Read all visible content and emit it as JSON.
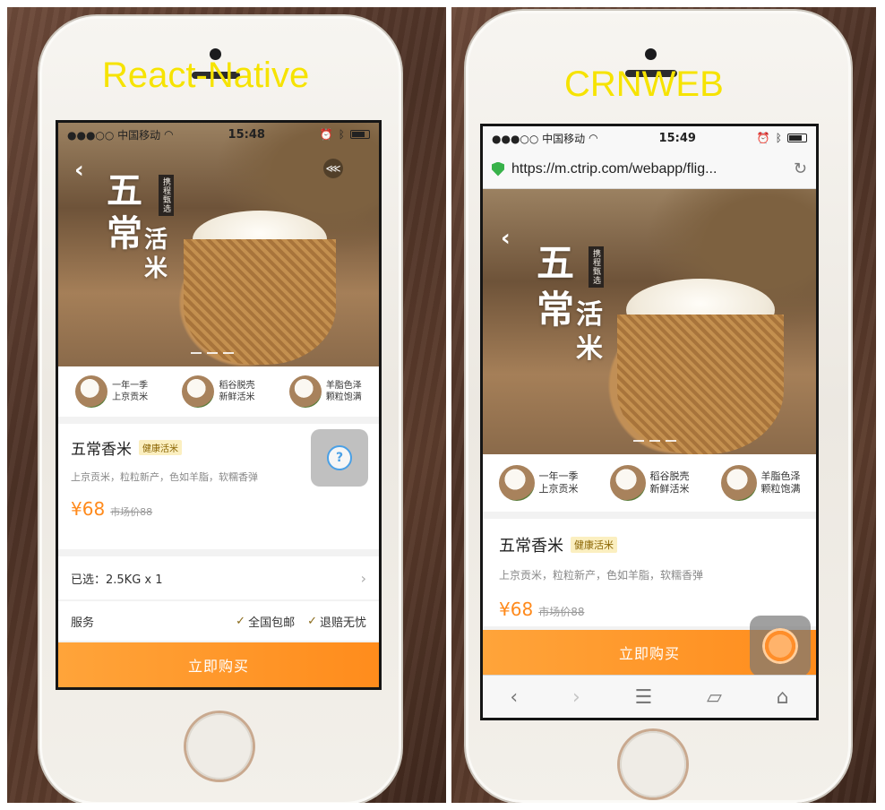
{
  "left": {
    "caption": "React-Native",
    "status": {
      "carrier": "●●●○○ 中国移动",
      "time": "15:48"
    },
    "hero": {
      "char1": "五",
      "char2": "常",
      "char3": "活",
      "char4": "米",
      "seal": "携程甄选"
    },
    "features": [
      {
        "line1": "一年一季",
        "line2": "上京贡米"
      },
      {
        "line1": "稻谷脱壳",
        "line2": "新鲜活米"
      },
      {
        "line1": "羊脂色泽",
        "line2": "颗粒饱满"
      }
    ],
    "product": {
      "title": "五常香米",
      "tag": "健康活米",
      "desc": "上京贡米，粒粒新产，色如羊脂，软糯香弹",
      "price": "¥68",
      "old_price": "市场价88"
    },
    "selected": "已选：2.5KG x 1",
    "service": {
      "label": "服务",
      "items": [
        "全国包邮",
        "退赔无忧"
      ]
    },
    "buy_label": "立即购买"
  },
  "right": {
    "caption": "CRNWEB",
    "status": {
      "carrier": "●●●○○ 中国移动",
      "time": "15:49"
    },
    "url": "https://m.ctrip.com/webapp/flig...",
    "hero": {
      "char1": "五",
      "char2": "常",
      "char3": "活",
      "char4": "米",
      "seal": "携程甄选"
    },
    "features": [
      {
        "line1": "一年一季",
        "line2": "上京贡米"
      },
      {
        "line1": "稻谷脱壳",
        "line2": "新鲜活米"
      },
      {
        "line1": "羊脂色泽",
        "line2": "颗粒饱满"
      }
    ],
    "product": {
      "title": "五常香米",
      "tag": "健康活米",
      "desc": "上京贡米，粒粒新产，色如羊脂，软糯香弹",
      "price": "¥68",
      "old_price": "市场价88"
    },
    "buy_label": "立即购买",
    "toolbar_icons": [
      "back-icon",
      "forward-icon",
      "menu-icon",
      "bookmarks-icon",
      "home-icon"
    ]
  }
}
